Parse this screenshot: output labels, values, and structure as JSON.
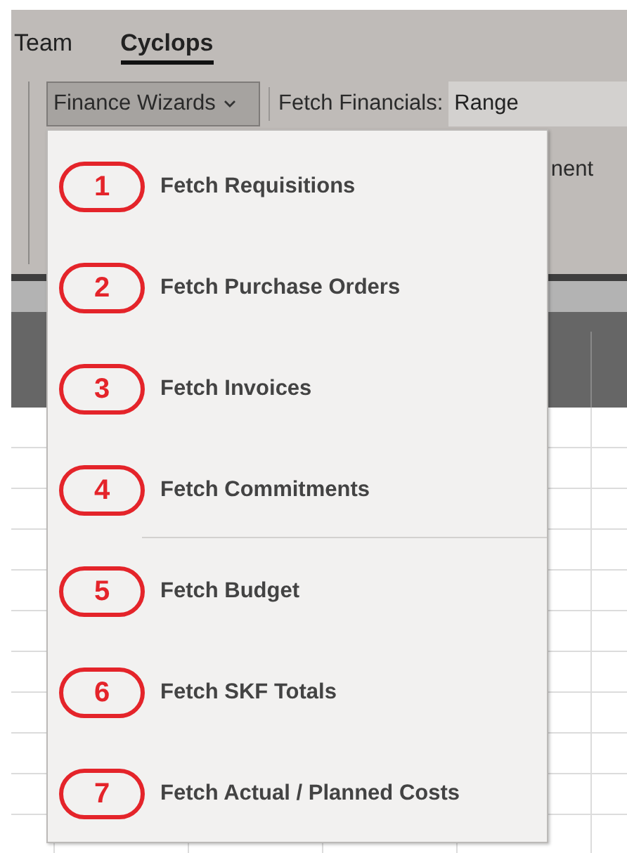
{
  "tabs": [
    {
      "label": "Team",
      "selected": false
    },
    {
      "label": "Cyclops",
      "selected": true
    }
  ],
  "ribbon": {
    "dropdown": {
      "label": "Finance Wizards",
      "expanded": true
    },
    "fetch_label": "Fetch Financials:",
    "range_field": {
      "value": "Range"
    },
    "partial_label": "nent"
  },
  "menu": {
    "groups": [
      [
        {
          "badge": "1",
          "label": "Fetch Requisitions"
        },
        {
          "badge": "2",
          "label": "Fetch Purchase Orders"
        },
        {
          "badge": "3",
          "label": "Fetch Invoices"
        },
        {
          "badge": "4",
          "label": "Fetch Commitments"
        }
      ],
      [
        {
          "badge": "5",
          "label": "Fetch Budget"
        },
        {
          "badge": "6",
          "label": "Fetch SKF Totals"
        },
        {
          "badge": "7",
          "label": "Fetch Actual / Planned Costs"
        }
      ]
    ]
  }
}
